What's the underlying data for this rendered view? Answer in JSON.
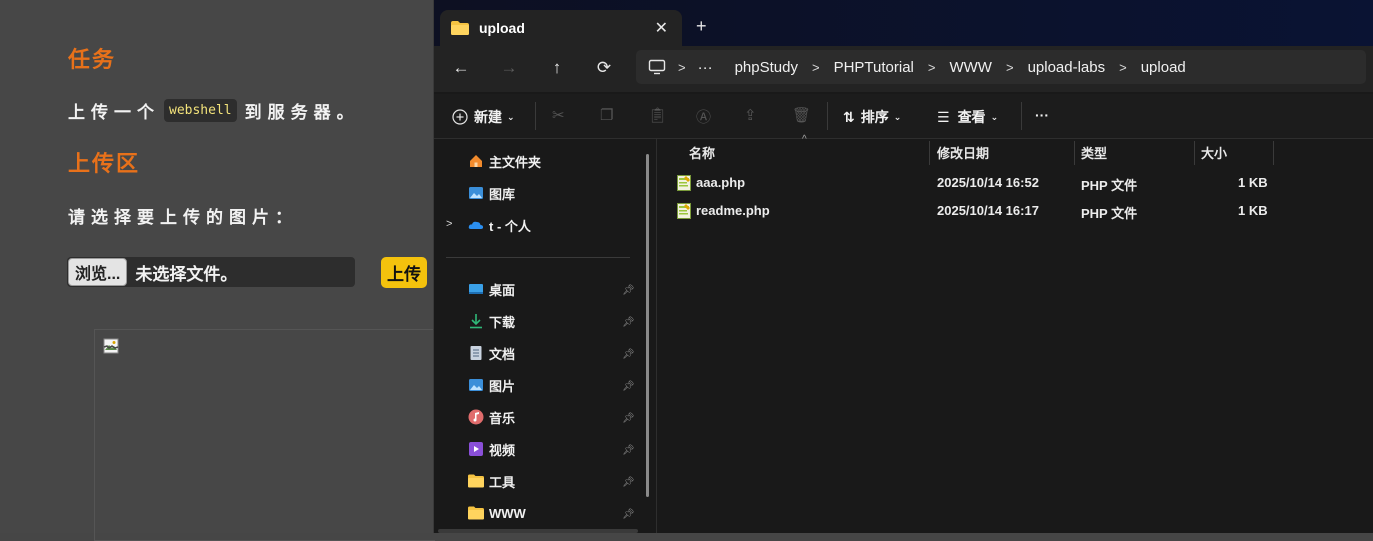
{
  "page": {
    "task_heading": "任务",
    "task_prefix": "上传一个",
    "task_code": "webshell",
    "task_suffix": "到服务器。",
    "upload_heading": "上传区",
    "choose_label": "请选择要上传的图片：",
    "browse_button": "浏览...",
    "no_file_text": "未选择文件。",
    "upload_button": "上传",
    "colors": {
      "accent": "#e8711a",
      "upload_button": "#f4c20d",
      "code_text": "#f2e27a"
    }
  },
  "explorer": {
    "tab_title": "upload",
    "tab_close": "✕",
    "new_tab": "+",
    "breadcrumb": [
      "phpStudy",
      "PHPTutorial",
      "WWW",
      "upload-labs",
      "upload"
    ],
    "breadcrumb_more": "···",
    "toolbar": {
      "new": "新建",
      "sort": "排序",
      "view": "查看",
      "more": "···"
    },
    "nav": {
      "home": "主文件夹",
      "gallery": "图库",
      "onedrive": "t - 个人",
      "desktop": "桌面",
      "downloads": "下载",
      "documents": "文档",
      "pictures": "图片",
      "music": "音乐",
      "videos": "视频",
      "tools": "工具",
      "www": "WWW"
    },
    "columns": {
      "name": "名称",
      "modified": "修改日期",
      "type": "类型",
      "size": "大小"
    },
    "files": [
      {
        "name": "aaa.php",
        "modified": "2025/10/14 16:52",
        "type": "PHP 文件",
        "size": "1 KB"
      },
      {
        "name": "readme.php",
        "modified": "2025/10/14 16:17",
        "type": "PHP 文件",
        "size": "1 KB"
      }
    ]
  }
}
